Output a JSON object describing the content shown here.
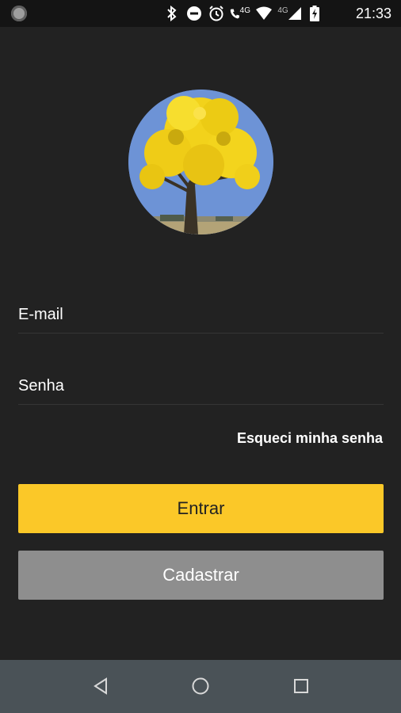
{
  "status_bar": {
    "time": "21:33",
    "network_label": "4G",
    "call_label": "4G",
    "icons": [
      "notification-dot-icon",
      "bluetooth-icon",
      "do-not-disturb-icon",
      "alarm-icon",
      "wifi-call-icon",
      "wifi-icon",
      "signal-icon",
      "battery-charging-icon"
    ]
  },
  "login": {
    "avatar_alt": "yellow-ipe-tree-avatar",
    "email_placeholder": "E-mail",
    "password_placeholder": "Senha",
    "forgot_password": "Esqueci minha senha",
    "login_button": "Entrar",
    "register_button": "Cadastrar"
  },
  "colors": {
    "background": "#222222",
    "primary_button": "#fbc828",
    "secondary_button": "#8e8e8e",
    "nav_bar": "#4a5257"
  },
  "nav_bar": {
    "icons": [
      "back-icon",
      "home-icon",
      "recents-icon"
    ]
  }
}
